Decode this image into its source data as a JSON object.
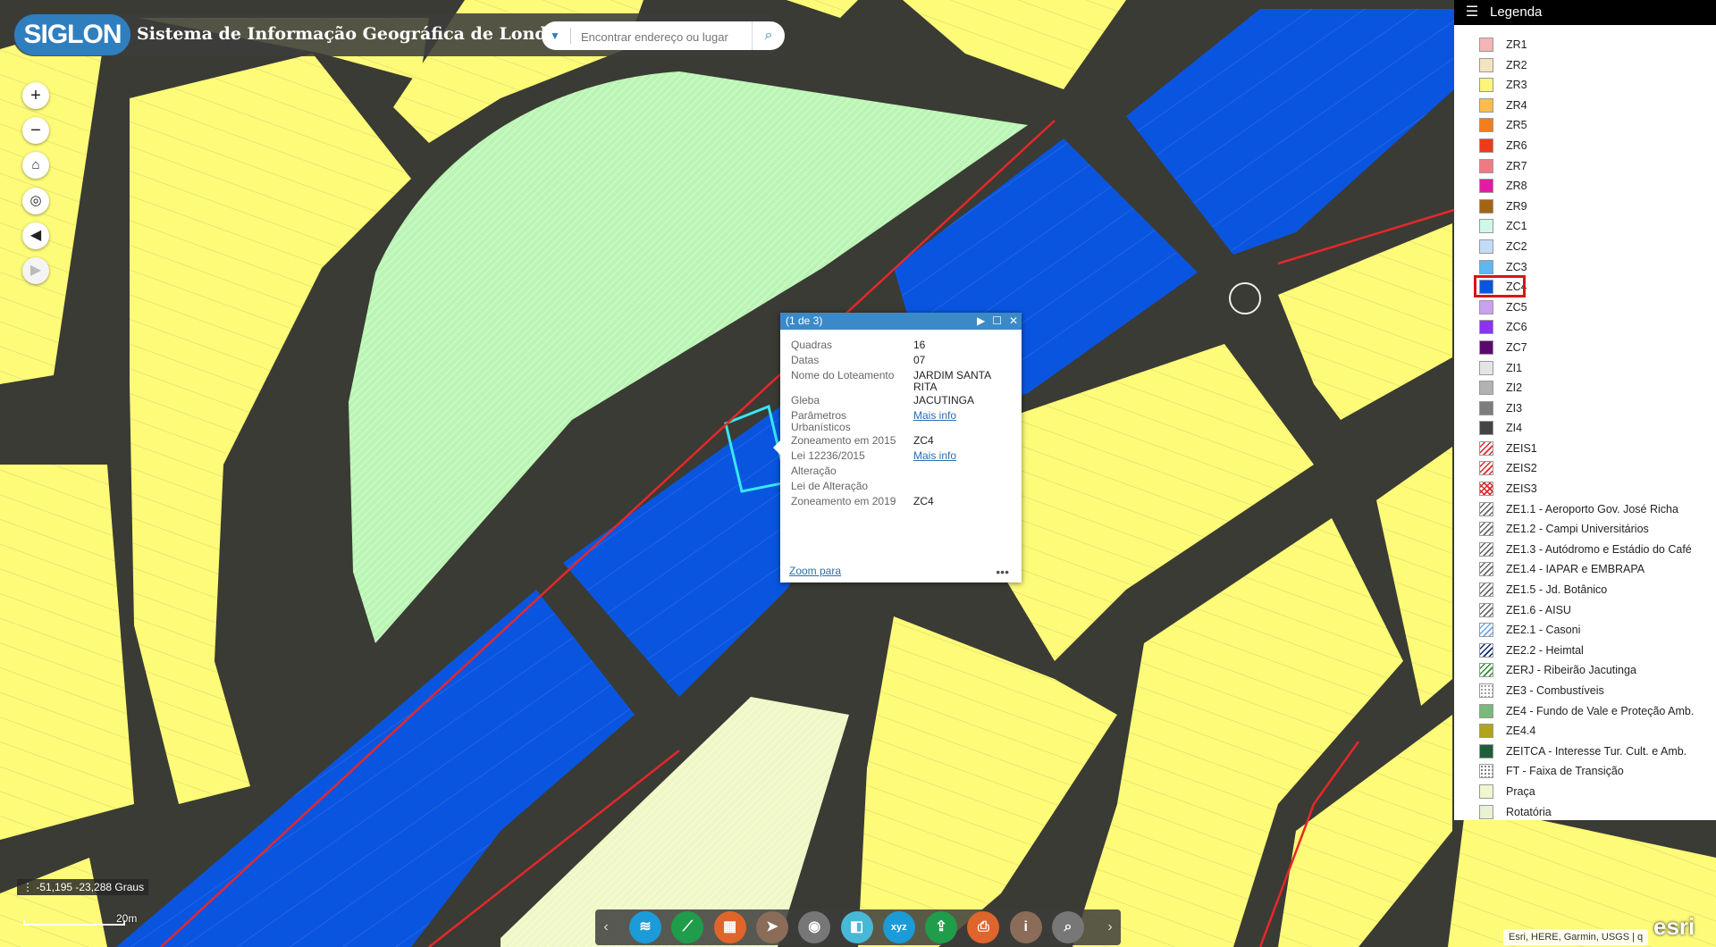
{
  "header": {
    "logo": "SIGLON",
    "title": "Sistema de Informação Geográfica de Londrina",
    "search_placeholder": "Encontrar endereço ou lugar"
  },
  "legend": {
    "title": "Legenda",
    "items": [
      {
        "label": "ZR1",
        "color": "#f6b5b5"
      },
      {
        "label": "ZR2",
        "color": "#f3e3bf"
      },
      {
        "label": "ZR3",
        "color": "#fdf47a"
      },
      {
        "label": "ZR4",
        "color": "#fcbb4a"
      },
      {
        "label": "ZR5",
        "color": "#f77d1a"
      },
      {
        "label": "ZR6",
        "color": "#ee3a1c"
      },
      {
        "label": "ZR7",
        "color": "#f07a84"
      },
      {
        "label": "ZR8",
        "color": "#e41ba1"
      },
      {
        "label": "ZR9",
        "color": "#a46512"
      },
      {
        "label": "ZC1",
        "color": "#cff8e6"
      },
      {
        "label": "ZC2",
        "color": "#c3dcf6"
      },
      {
        "label": "ZC3",
        "color": "#5cb7f2"
      },
      {
        "label": "ZC4",
        "color": "#0a55e0"
      },
      {
        "label": "ZC5",
        "color": "#c9a2ee"
      },
      {
        "label": "ZC6",
        "color": "#8c32f4"
      },
      {
        "label": "ZC7",
        "color": "#5a0a6e"
      },
      {
        "label": "ZI1",
        "color": "#e4e4e4"
      },
      {
        "label": "ZI2",
        "color": "#b2b2b2"
      },
      {
        "label": "ZI3",
        "color": "#7d7d7d"
      },
      {
        "label": "ZI4",
        "color": "#444444"
      },
      {
        "label": "ZEIS1",
        "color": "#e02424",
        "pattern": "hatch"
      },
      {
        "label": "ZEIS2",
        "color": "#e02424",
        "pattern": "hatch"
      },
      {
        "label": "ZEIS3",
        "color": "#e02424",
        "pattern": "cross"
      },
      {
        "label": "ZE1.1 - Aeroporto Gov. José Richa",
        "color": "#666666",
        "pattern": "hatch"
      },
      {
        "label": "ZE1.2 - Campi Universitários",
        "color": "#666666",
        "pattern": "hatch"
      },
      {
        "label": "ZE1.3 - Autódromo e Estádio do Café",
        "color": "#666666",
        "pattern": "hatch"
      },
      {
        "label": "ZE1.4 - IAPAR e EMBRAPA",
        "color": "#666666",
        "pattern": "hatch"
      },
      {
        "label": "ZE1.5 - Jd. Botânico",
        "color": "#666666",
        "pattern": "hatch"
      },
      {
        "label": "ZE1.6 - AISU",
        "color": "#666666",
        "pattern": "hatch"
      },
      {
        "label": "ZE2.1 - Casoni",
        "color": "#6aa8e8",
        "pattern": "hatch"
      },
      {
        "label": "ZE2.2 - Heimtal",
        "color": "#0b2a6e",
        "pattern": "hatch"
      },
      {
        "label": "ZERJ - Ribeirão Jacutinga",
        "color": "#2e8b2e",
        "pattern": "hatch"
      },
      {
        "label": "ZE3 - Combustíveis",
        "color": "#999999",
        "pattern": "dots"
      },
      {
        "label": "ZE4 - Fundo de Vale e Proteção Amb.",
        "color": "#79b979"
      },
      {
        "label": "ZE4.4",
        "color": "#b0a41a"
      },
      {
        "label": "ZEITCA - Interesse Tur. Cult. e Amb.",
        "color": "#1f5e3c"
      },
      {
        "label": "FT - Faixa de Transição",
        "color": "#777777",
        "pattern": "dots"
      },
      {
        "label": "Praça",
        "color": "#eff7cc"
      },
      {
        "label": "Rotatória",
        "color": "#e9f3d4"
      }
    ],
    "selected": "ZC4"
  },
  "popup": {
    "title": "(1 de 3)",
    "rows": [
      {
        "key": "Quadras",
        "value": "16"
      },
      {
        "key": "Datas",
        "value": "07"
      },
      {
        "key": "Nome do Loteamento",
        "value": "JARDIM SANTA RITA"
      },
      {
        "key": "Gleba",
        "value": "JACUTINGA"
      },
      {
        "key": "Parâmetros Urbanísticos",
        "value": "Mais info",
        "link": true
      },
      {
        "key": "Zoneamento em 2015",
        "value": "ZC4"
      },
      {
        "key": "Lei 12236/2015",
        "value": "Mais info",
        "link": true
      },
      {
        "key": "Alteração",
        "value": ""
      },
      {
        "key": "Lei de Alteração",
        "value": ""
      },
      {
        "key": "Zoneamento em 2019",
        "value": "ZC4"
      }
    ],
    "zoom_link": "Zoom para",
    "more": "•••"
  },
  "map": {
    "coords": "-51,195 -23,288 Graus",
    "scale": "20m",
    "attribution": "Esri, HERE, Garmin, USGS | q",
    "esri": "esri"
  },
  "toolbar": {
    "tools": [
      {
        "name": "layers-icon",
        "color": "#1b9bd8",
        "glyph": "≋"
      },
      {
        "name": "measure-icon",
        "color": "#1f9d4a",
        "glyph": "⟋"
      },
      {
        "name": "basemap-gallery-icon",
        "color": "#e0652a",
        "glyph": "▦"
      },
      {
        "name": "filter-icon",
        "color": "#8a6c58",
        "glyph": "➤"
      },
      {
        "name": "location-icon",
        "color": "#777777",
        "glyph": "◉"
      },
      {
        "name": "swipe-icon",
        "color": "#49b8d8",
        "glyph": "◧"
      },
      {
        "name": "xyz-icon",
        "color": "#1b9bd8",
        "glyph": "xyz"
      },
      {
        "name": "share-icon",
        "color": "#1f9d4a",
        "glyph": "⇪"
      },
      {
        "name": "print-icon",
        "color": "#e0652a",
        "glyph": "⎙"
      },
      {
        "name": "about-icon",
        "color": "#8a6c58",
        "glyph": "i"
      },
      {
        "name": "query-icon",
        "color": "#777777",
        "glyph": "⌕"
      }
    ]
  }
}
